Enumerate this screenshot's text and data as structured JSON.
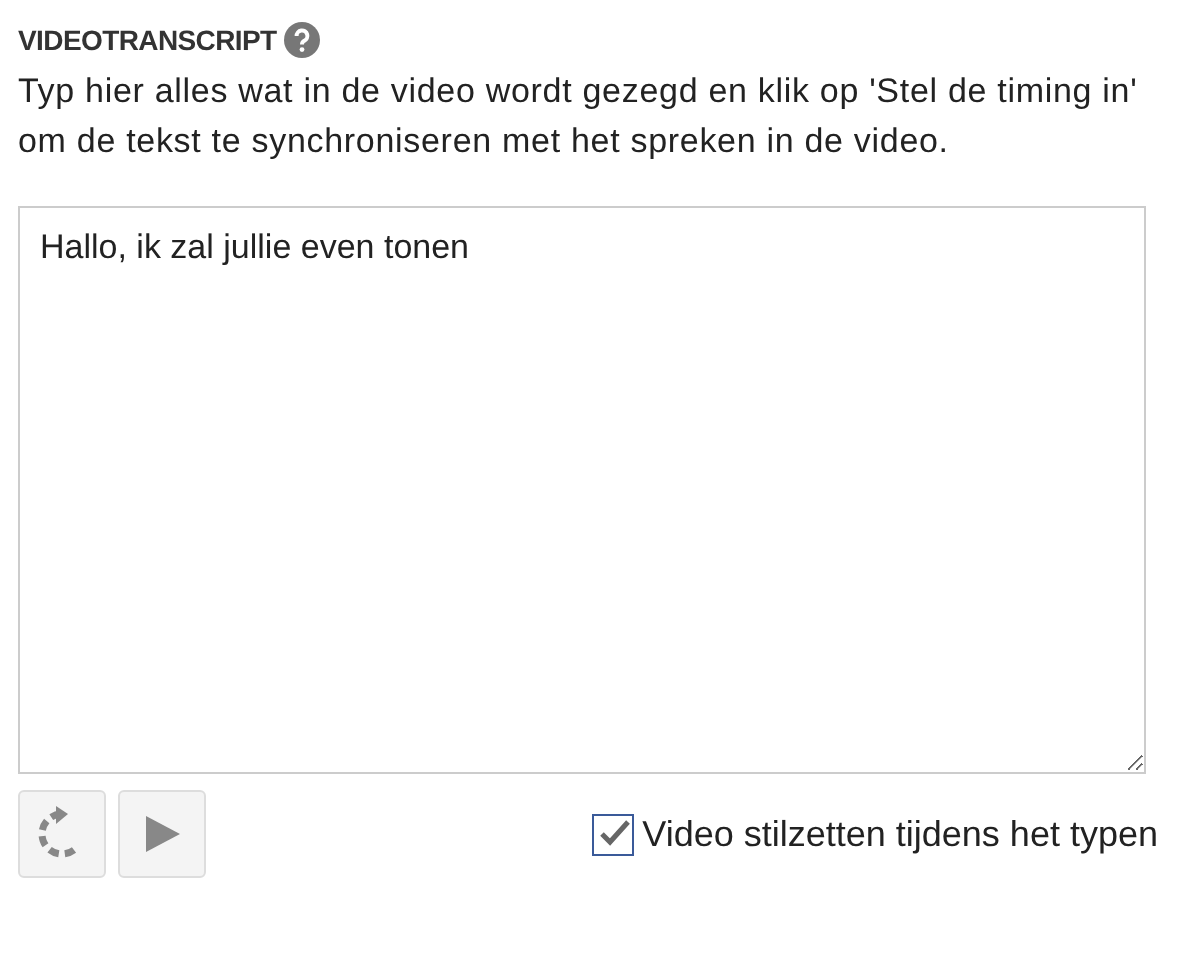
{
  "heading": "VIDEOTRANSCRIPT",
  "instructions": "Typ hier alles wat in de video wordt gezegd en klik op 'Stel de timing in' om de tekst te synchroniseren met het spreken in de video.",
  "transcript": {
    "value": "Hallo, ik zal jullie even tonen"
  },
  "pause_while_typing": {
    "label": "Video stilzetten tijdens het typen",
    "checked": true
  }
}
